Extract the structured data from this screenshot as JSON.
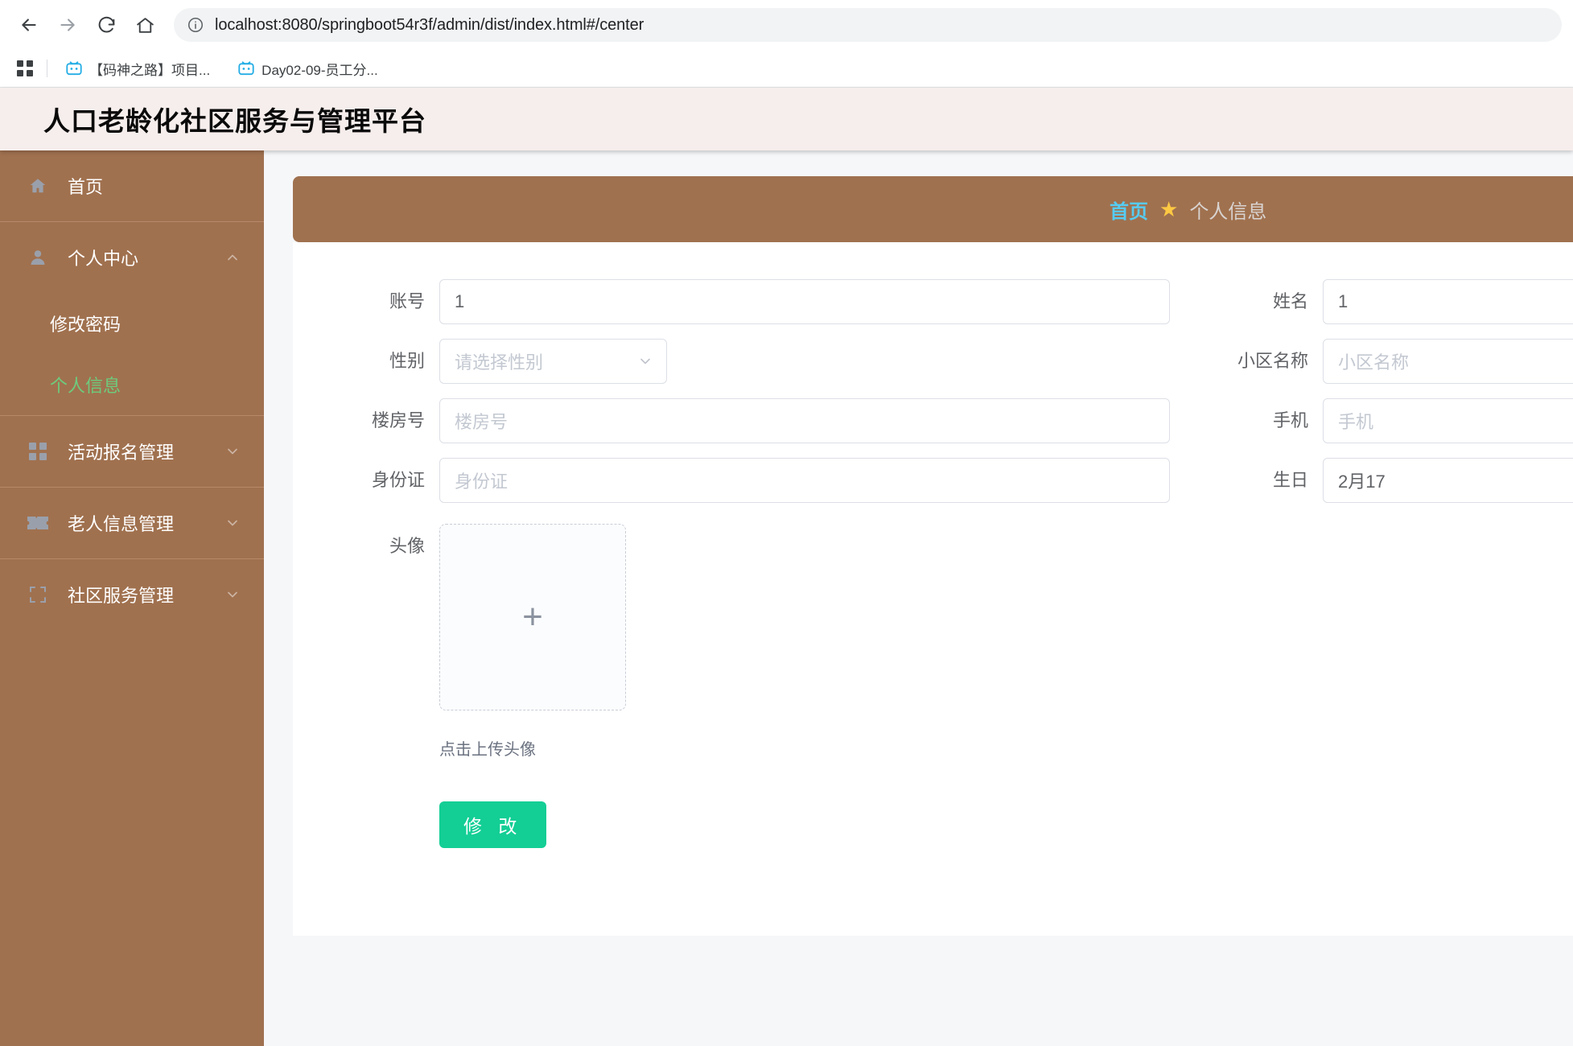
{
  "browser": {
    "back_label": "back",
    "forward_label": "forward",
    "reload_label": "reload",
    "home_label": "home",
    "url": "localhost:8080/springboot54r3f/admin/dist/index.html#/center",
    "bookmarks": [
      {
        "label": "【码神之路】项目...",
        "icon": "bilibili-tv-icon"
      },
      {
        "label": "Day02-09-员工分...",
        "icon": "bilibili-tv-icon"
      }
    ]
  },
  "header": {
    "title": "人口老龄化社区服务与管理平台",
    "bg": "#f6eeec"
  },
  "colors": {
    "sidebar": "#a0714f",
    "accent_green": "#13ce95",
    "crumb_link": "#56ccf2",
    "star": "#ffc943",
    "active_menu": "#6ecb7e"
  },
  "sidebar": {
    "items": [
      {
        "label": "首页",
        "icon": "home-icon",
        "arrow": "",
        "expanded": false,
        "children": []
      },
      {
        "label": "个人中心",
        "icon": "user-icon",
        "arrow": "chevron-up-icon",
        "expanded": true,
        "children": [
          {
            "label": "修改密码",
            "active": false
          },
          {
            "label": "个人信息",
            "active": true
          }
        ]
      },
      {
        "label": "活动报名管理",
        "icon": "grid-icon",
        "arrow": "chevron-down-icon",
        "expanded": false,
        "children": []
      },
      {
        "label": "老人信息管理",
        "icon": "ticket-icon",
        "arrow": "chevron-down-icon",
        "expanded": false,
        "children": []
      },
      {
        "label": "社区服务管理",
        "icon": "crop-icon",
        "arrow": "chevron-down-icon",
        "expanded": false,
        "children": []
      }
    ]
  },
  "breadcrumb": {
    "home": "首页",
    "separator_icon": "star-icon",
    "current": "个人信息"
  },
  "form": {
    "rows": [
      {
        "left": {
          "label": "账号",
          "value": "1",
          "placeholder": "",
          "type": "input",
          "is_placeholder": false
        },
        "right": {
          "label": "姓名",
          "value": "1",
          "placeholder": "",
          "type": "input",
          "is_placeholder": false
        }
      },
      {
        "left": {
          "label": "性别",
          "value": "请选择性别",
          "placeholder": "请选择性别",
          "type": "select",
          "is_placeholder": true
        },
        "right": {
          "label": "小区名称",
          "value": "小区名称",
          "placeholder": "小区名称",
          "type": "input",
          "is_placeholder": true
        }
      },
      {
        "left": {
          "label": "楼房号",
          "value": "楼房号",
          "placeholder": "楼房号",
          "type": "input",
          "is_placeholder": true
        },
        "right": {
          "label": "手机",
          "value": "手机",
          "placeholder": "手机",
          "type": "input",
          "is_placeholder": true
        }
      },
      {
        "left": {
          "label": "身份证",
          "value": "身份证",
          "placeholder": "身份证",
          "type": "input",
          "is_placeholder": true
        },
        "right": {
          "label": "生日",
          "value": "2月17",
          "placeholder": "",
          "type": "input",
          "is_placeholder": false
        }
      }
    ],
    "upload": {
      "label": "头像",
      "plus": "+",
      "tip": "点击上传头像"
    },
    "submit_label": "修 改"
  }
}
